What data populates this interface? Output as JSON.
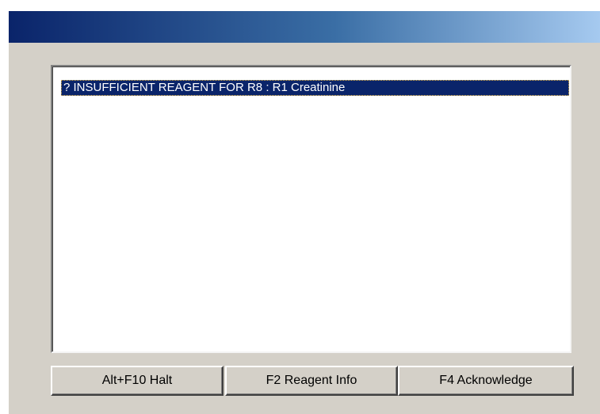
{
  "title_bar": {
    "title": ""
  },
  "message_list": {
    "items": [
      {
        "text": "? INSUFFICIENT REAGENT FOR R8 : R1 Creatinine",
        "selected": true
      }
    ]
  },
  "buttons": {
    "halt_label": "Alt+F10 Halt",
    "reagent_info_label": "F2 Reagent Info",
    "acknowledge_label": "F4 Acknowledge"
  }
}
